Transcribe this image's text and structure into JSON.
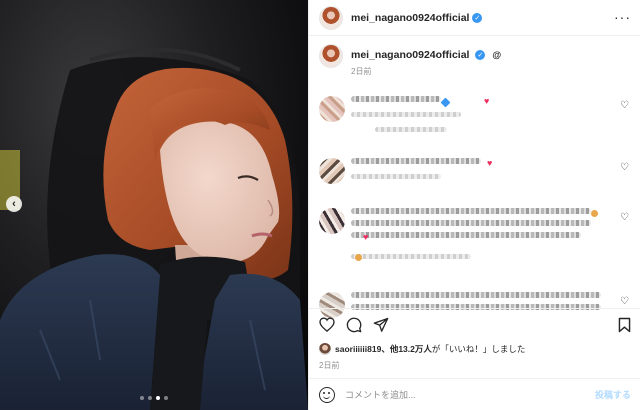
{
  "post": {
    "username": "mei_nagano0924official",
    "timestamp": "2日前",
    "colors": {
      "verified": "#3897f0",
      "hair": "#b0512e",
      "like_heart": "#ed2c5e",
      "post_disabled": "#b3dbff"
    }
  },
  "media": {
    "slide_count": 4,
    "active_slide": 3,
    "prev_button_icon": "chevron-left-icon"
  },
  "header": {
    "username": "mei_nagano0924official",
    "more_icon": "more-horizontal-icon"
  },
  "comments": {
    "items": [
      {
        "blurred": true,
        "reply_text": ""
      },
      {
        "blurred": true
      },
      {
        "blurred": true
      },
      {
        "blurred": true
      }
    ]
  },
  "actions": {
    "icons": [
      "heart-icon",
      "comment-icon",
      "share-icon",
      "bookmark-icon"
    ]
  },
  "likes": {
    "first_liker": "saoriiiiii819",
    "count_text": "、他13.2万人",
    "suffix": "が「いいね！」しました"
  },
  "footer": {
    "date": "2日前",
    "comment_placeholder": "コメントを追加...",
    "post_button": "投稿する"
  }
}
